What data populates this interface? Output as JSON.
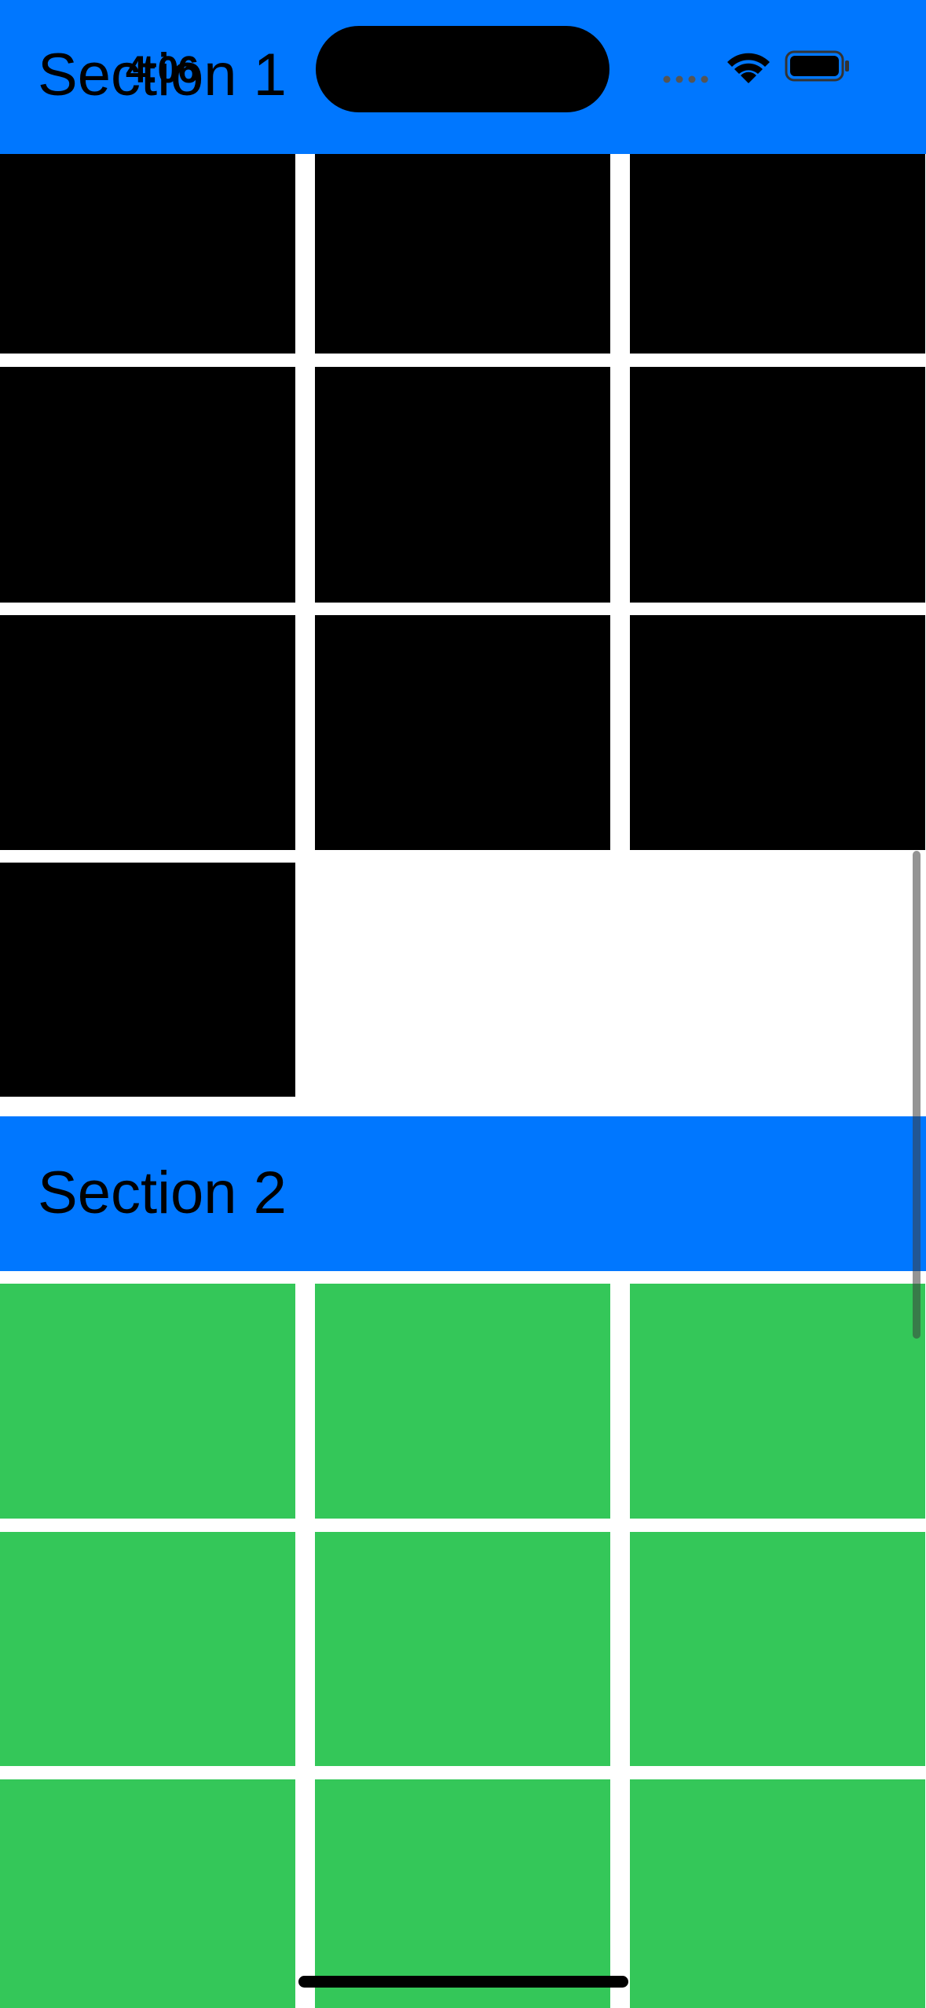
{
  "status_bar": {
    "time": "4:06",
    "wifi_icon": "wifi-icon",
    "battery_icon": "battery-icon",
    "signal_icon": "cellular-signal-icon"
  },
  "sections": [
    {
      "title": "Section 1",
      "header_color": "#0077ff",
      "cell_color": "#000000",
      "visible_cells": 10
    },
    {
      "title": "Section 2",
      "header_color": "#0077ff",
      "cell_color": "#34c759",
      "visible_cells": 9
    }
  ]
}
